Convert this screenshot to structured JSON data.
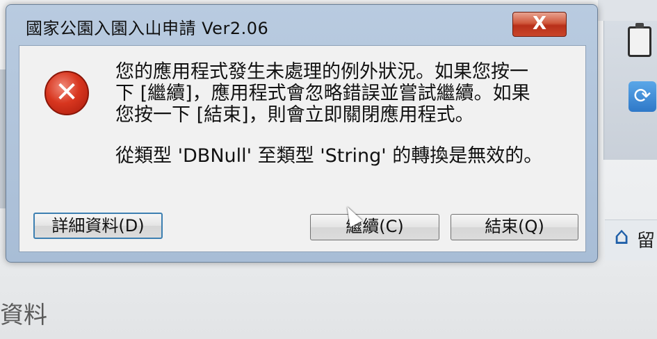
{
  "dialog": {
    "title": "國家公園入園入山申請 Ver2.06",
    "close_label": "X",
    "message_lines": [
      "您的應用程式發生未處理的例外狀況。如果您按一",
      "下 [繼續]，應用程式會忽略錯誤並嘗試繼續。如果",
      "您按一下 [結束]，則會立即關閉應用程式。"
    ],
    "detail": "從類型 'DBNull' 至類型 'String' 的轉換是無效的。",
    "buttons": {
      "details": "詳細資料(D)",
      "continue": "繼續(C)",
      "quit": "結束(Q)"
    },
    "icon": "error-icon"
  },
  "background": {
    "home_label": "留",
    "bottom_label": "資料"
  }
}
